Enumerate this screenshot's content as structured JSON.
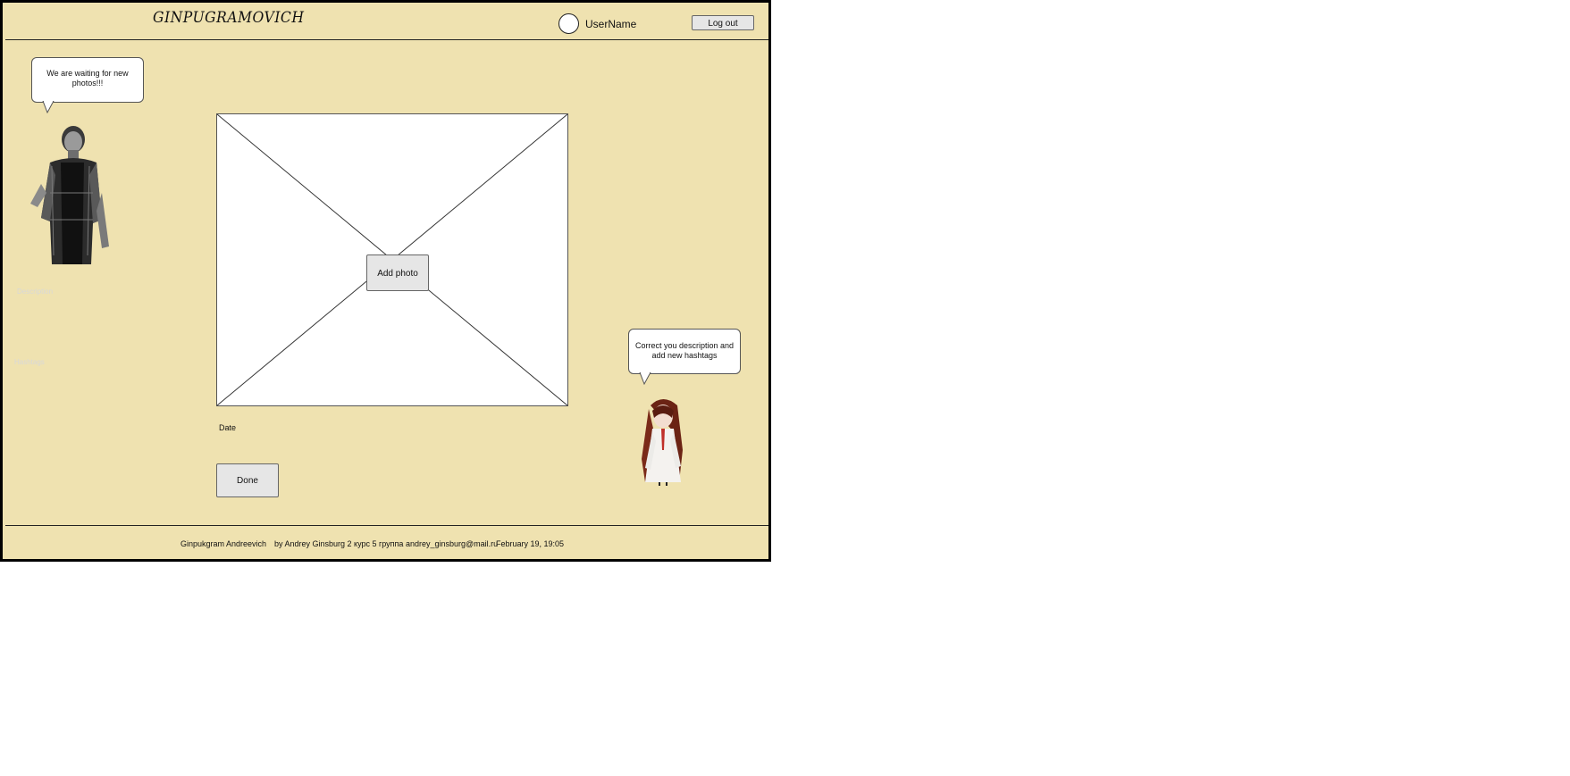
{
  "header": {
    "logo": "GINPUGRAMOVICH",
    "username": "UserName",
    "logout_label": "Log out"
  },
  "left_panel": {
    "bubble_text": "We are waiting for new photos!!!",
    "description_label": "Description",
    "hashtags_label": "Hashtags"
  },
  "main": {
    "add_photo_label": "Add photo",
    "date_label": "Date",
    "done_label": "Done"
  },
  "right_panel": {
    "bubble_text": "Correct you description and add new hashtags"
  },
  "footer": {
    "name": "Ginpukgram Andreevich",
    "credits": "by Andrey Ginsburg 2 курс 5 группа andrey_ginsburg@mail.ru",
    "timestamp": "February 19, 19:05"
  },
  "colors": {
    "background": "#efe2b0",
    "frame_border": "#000000",
    "button_bg": "#e6e6e6"
  }
}
